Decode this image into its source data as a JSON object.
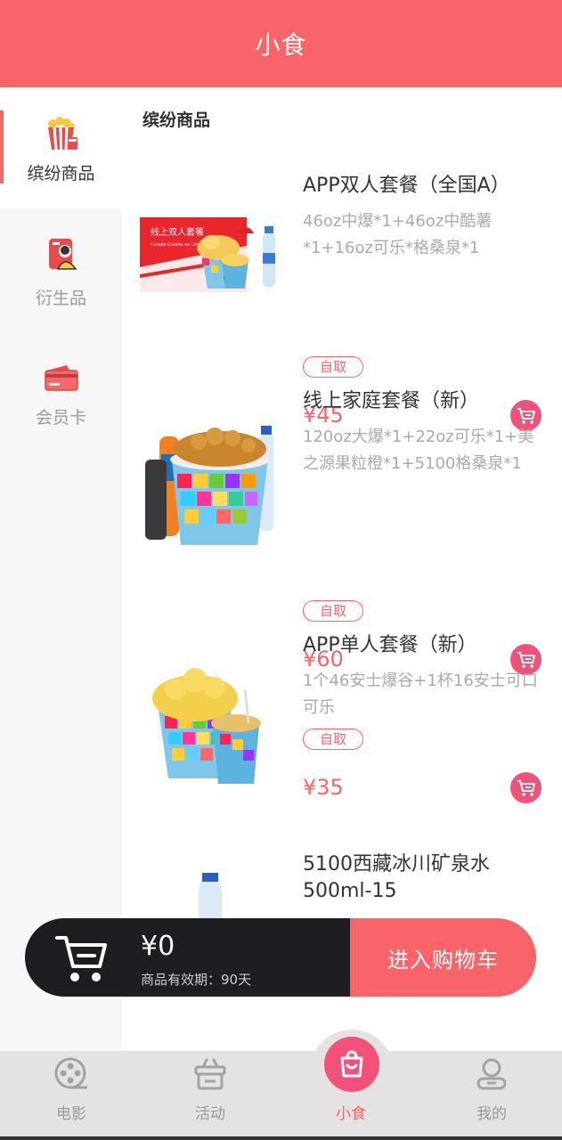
{
  "header": {
    "title": "小食"
  },
  "sidebar": {
    "items": [
      {
        "label": "缤纷商品",
        "icon": "popcorn-icon",
        "active": true
      },
      {
        "label": "衍生品",
        "icon": "merchandise-icon",
        "active": false
      },
      {
        "label": "会员卡",
        "icon": "member-card-icon",
        "active": false
      }
    ]
  },
  "main": {
    "section_title": "缤纷商品",
    "products": [
      {
        "name": "APP双人套餐（全国A）",
        "desc": "46oz中爆*1+46oz中酷薯*1+16oz可乐*格桑泉*1",
        "tag": "自取",
        "price": "¥45",
        "image_caption": "线上双人套餐",
        "image_subcaption": "Couple Combo on Line"
      },
      {
        "name": "线上家庭套餐（新）",
        "desc": "120oz大爆*1+22oz可乐*1+美之源果粒橙*1+5100格桑泉*1",
        "tag": "自取",
        "price": "¥60"
      },
      {
        "name": "APP单人套餐（新）",
        "desc": "1个46安士爆谷+1杯16安士可口可乐",
        "tag": "自取",
        "price": "¥35"
      },
      {
        "name": "5100西藏冰川矿泉水500ml-15",
        "desc": "",
        "tag": "",
        "price": ""
      }
    ]
  },
  "cart": {
    "amount": "¥0",
    "validity": "商品有效期：90天",
    "checkout_label": "进入购物车"
  },
  "tabbar": {
    "tabs": [
      {
        "label": "电影",
        "icon": "film-reel-icon",
        "active": false
      },
      {
        "label": "活动",
        "icon": "gift-icon",
        "active": false
      },
      {
        "label": "小食",
        "icon": "shopping-bag-icon",
        "active": true
      },
      {
        "label": "我的",
        "icon": "user-icon",
        "active": false
      }
    ]
  },
  "colors": {
    "primary": "#f96469",
    "cart_button": "#f2527a",
    "dark_bar": "#1e1e22"
  }
}
